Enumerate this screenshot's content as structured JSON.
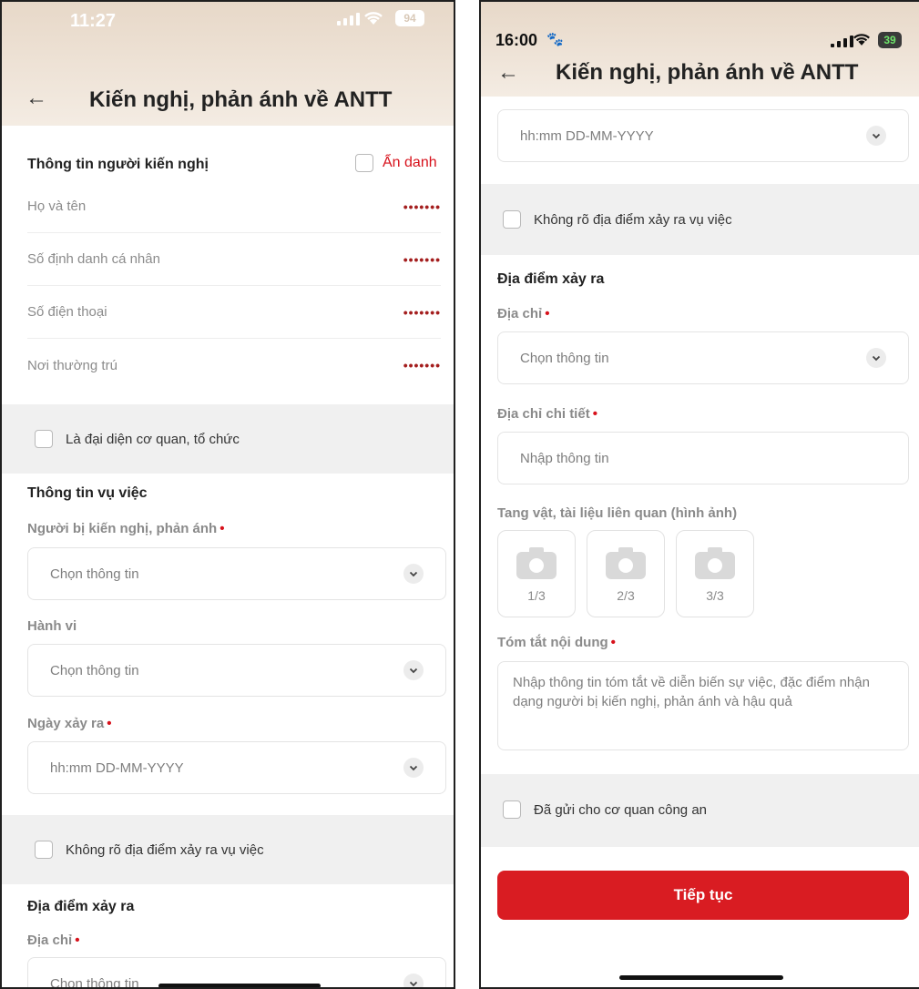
{
  "left": {
    "status": {
      "time": "11:27",
      "battery": "94"
    },
    "nav": {
      "back_icon": "←",
      "title": "Kiến nghị, phản ánh về ANTT"
    },
    "petitioner": {
      "title": "Thông tin người kiến nghị",
      "anonymous_label": "Ẩn danh",
      "rows": [
        {
          "label": "Họ và tên",
          "value": "•••••••"
        },
        {
          "label": "Số định danh cá nhân",
          "value": "•••••••"
        },
        {
          "label": "Số điện thoại",
          "value": "•••••••"
        },
        {
          "label": "Nơi thường trú",
          "value": "•••••••"
        }
      ]
    },
    "representative_checkbox": "Là đại diện cơ quan, tổ chức",
    "case": {
      "title": "Thông tin vụ việc",
      "accused_label": "Người bị kiến nghị, phản ánh",
      "accused_placeholder": "Chọn thông tin",
      "behavior_label": "Hành vi",
      "behavior_placeholder": "Chọn thông tin",
      "date_label": "Ngày xảy ra",
      "date_placeholder": "hh:mm DD-MM-YYYY"
    },
    "unknown_location_checkbox": "Không rõ địa điểm xảy ra vụ việc",
    "location": {
      "title": "Địa điểm xảy ra",
      "address_label": "Địa chỉ",
      "address_placeholder": "Chọn thông tin"
    },
    "required_mark": "•"
  },
  "right": {
    "status": {
      "time": "16:00",
      "battery": "39"
    },
    "nav": {
      "back_icon": "←",
      "title": "Kiến nghị, phản ánh về ANTT"
    },
    "date_placeholder": "hh:mm DD-MM-YYYY",
    "unknown_location_checkbox": "Không rõ địa điểm xảy ra vụ việc",
    "location": {
      "title": "Địa điểm xảy ra",
      "address_label": "Địa chỉ",
      "address_placeholder": "Chọn thông tin",
      "detail_label": "Địa chỉ chi tiết",
      "detail_placeholder": "Nhập thông tin"
    },
    "evidence": {
      "label": "Tang vật, tài liệu liên quan (hình ảnh)",
      "slots": [
        "1/3",
        "2/3",
        "3/3"
      ]
    },
    "summary": {
      "label": "Tóm tắt nội dung",
      "placeholder": "Nhập thông tin tóm tắt về diễn biến sự việc, đặc điểm nhận dạng người bị kiến nghị, phản ánh và hậu quả"
    },
    "sent_checkbox": "Đã gửi cho cơ quan công an",
    "continue_button": "Tiếp tục",
    "required_mark": "•"
  },
  "colors": {
    "accent": "#d91c22",
    "header_bg": "#e7d8c8",
    "band_bg": "#f0f0f0"
  }
}
